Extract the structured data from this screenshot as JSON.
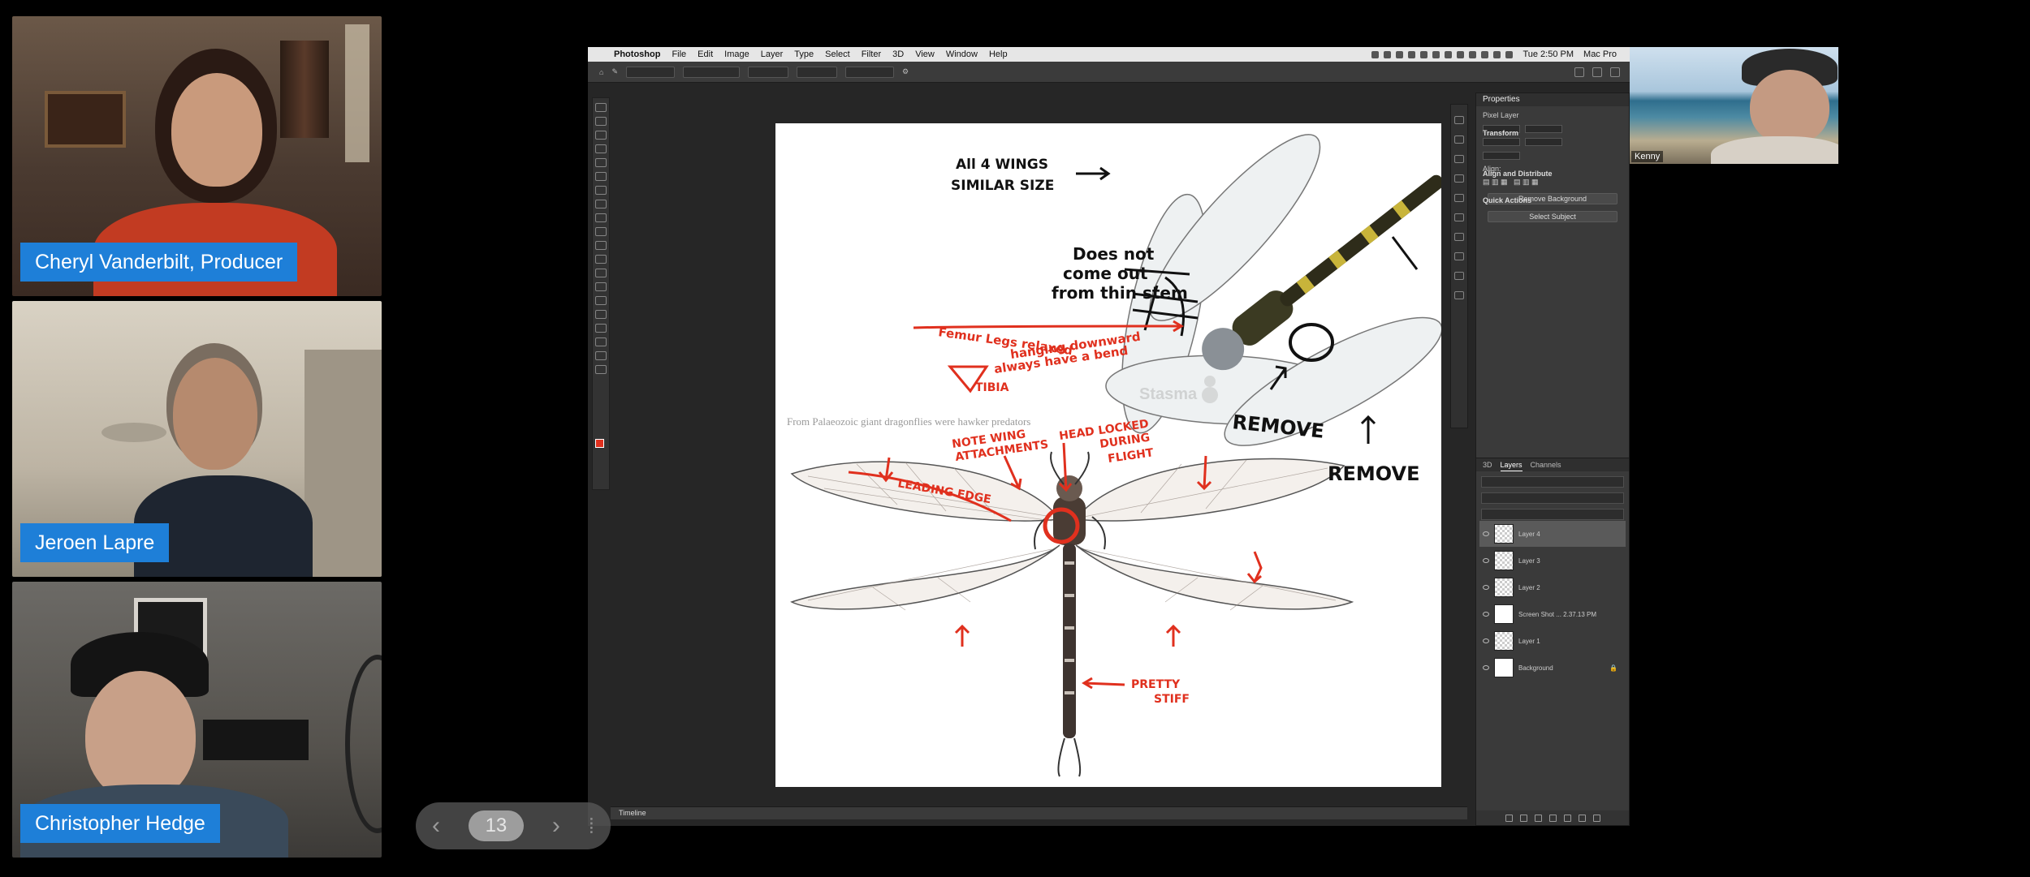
{
  "participants": [
    {
      "name": "Cheryl Vanderbilt, Producer"
    },
    {
      "name": "Jeroen Lapre"
    },
    {
      "name": "Christopher Hedge"
    }
  ],
  "self_view": {
    "name": "Kenny"
  },
  "pager": {
    "page": "13",
    "prev_icon": "‹",
    "next_icon": "›"
  },
  "photoshop": {
    "menu": [
      "Photoshop",
      "File",
      "Edit",
      "Image",
      "Layer",
      "Type",
      "Select",
      "Filter",
      "3D",
      "View",
      "Window",
      "Help"
    ],
    "clock": "Tue 2:50 PM",
    "machine": "Mac Pro",
    "panels": {
      "properties_tab": "Properties",
      "pixel_layer": "Pixel Layer",
      "transform": "Transform",
      "align": "Align and Distribute",
      "align_sub": "Align:",
      "quick_actions": "Quick Actions",
      "remove_bg": "Remove Background",
      "select_subject": "Select Subject"
    },
    "layers_tabs": [
      "3D",
      "Layers",
      "Channels"
    ],
    "layers": [
      "Layer 4",
      "Layer 3",
      "Layer 2",
      "Screen Shot ... 2.37.13 PM",
      "Layer 1",
      "Background"
    ],
    "timeline": "Timeline"
  },
  "annotations": {
    "wings": [
      "All 4 WINGS",
      "SIMILAR SIZE"
    ],
    "stem": [
      "Does not",
      "come out",
      "from thin stem"
    ],
    "legs": [
      "Femur  Legs relaxed",
      "hanging downward",
      "always have a bend",
      "TIBIA"
    ],
    "remove1": "REMOVE",
    "remove2": "REMOVE",
    "note_wing": [
      "NOTE WING",
      "ATTACHMENTS"
    ],
    "head_locked": [
      "HEAD LOCKED",
      "DURING",
      "FLIGHT"
    ],
    "leading_edge": "LEADING EDGE",
    "pretty_stiff": [
      "PRETTY",
      "STIFF"
    ],
    "caption_text": "From Palaeozoic giant dragonflies were hawker predators",
    "watermark": "Stasma"
  },
  "colors": {
    "name_tag": "#1e7fd8",
    "ink_red": "#e0301e",
    "ink_black": "#111111"
  }
}
